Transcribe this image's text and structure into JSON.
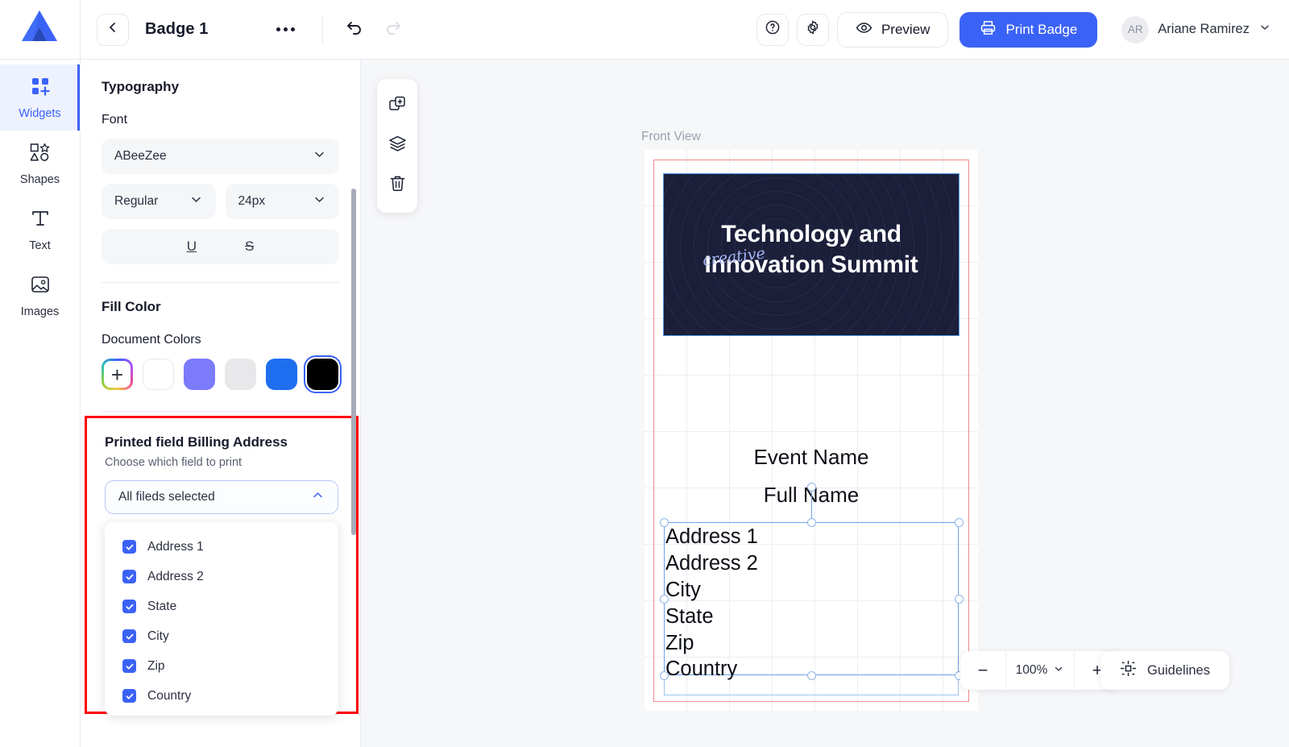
{
  "header": {
    "logo_icon": "app-logo-icon",
    "back_icon": "chevron-left-icon",
    "doc_title": "Badge 1",
    "more_icon": "more-options-icon",
    "undo_icon": "undo-icon",
    "redo_icon": "redo-icon",
    "help_icon": "help-circle-icon",
    "settings_icon": "gear-icon",
    "preview_label": "Preview",
    "preview_icon": "eye-icon",
    "print_label": "Print Badge",
    "print_icon": "printer-icon",
    "user_initials": "AR",
    "user_name": "Ariane Ramirez",
    "user_chevron_icon": "chevron-down-icon",
    "accent_color": "#3b62f6"
  },
  "rail": {
    "items": [
      {
        "label": "Widgets",
        "icon": "widgets-icon",
        "active": true
      },
      {
        "label": "Shapes",
        "icon": "shapes-icon",
        "active": false
      },
      {
        "label": "Text",
        "icon": "text-icon",
        "active": false
      },
      {
        "label": "Images",
        "icon": "images-icon",
        "active": false
      }
    ]
  },
  "panel": {
    "typography_title": "Typography",
    "font_label": "Font",
    "font_family_value": "ABeeZee",
    "font_weight_value": "Regular",
    "font_size_value": "24px",
    "underline_icon": "underline-icon",
    "underline_glyph": "U",
    "strikethrough_icon": "strikethrough-icon",
    "strikethrough_glyph": "S",
    "fill_color_title": "Fill Color",
    "document_colors_label": "Document Colors",
    "swatches": [
      {
        "name": "add-color-swatch",
        "color": "rainbow"
      },
      {
        "name": "swatch-white",
        "color": "#ffffff"
      },
      {
        "name": "swatch-periwinkle",
        "color": "#7b7bfb"
      },
      {
        "name": "swatch-light-gray",
        "color": "#e8e8ea"
      },
      {
        "name": "swatch-blue",
        "color": "#1f6ef0"
      },
      {
        "name": "swatch-black",
        "color": "#000000",
        "selected": true
      }
    ]
  },
  "printed_field": {
    "title": "Printed field Billing Address",
    "subtitle": "Choose which field to print",
    "select_value": "All fileds selected",
    "select_chevron_icon": "chevron-up-icon",
    "highlight_color": "#ff0000",
    "options": [
      {
        "label": "Address 1",
        "checked": true
      },
      {
        "label": "Address 2",
        "checked": true
      },
      {
        "label": "State",
        "checked": true
      },
      {
        "label": "City",
        "checked": true
      },
      {
        "label": "Zip",
        "checked": true
      },
      {
        "label": "Country",
        "checked": true
      }
    ]
  },
  "float_tools": [
    {
      "name": "duplicate-icon"
    },
    {
      "name": "layers-icon"
    },
    {
      "name": "delete-icon"
    }
  ],
  "canvas": {
    "view_label": "Front View",
    "badge": {
      "header_bg": "#1b1f3a",
      "script_word": "creative",
      "title_line1": "Technology and",
      "title_line2": "Innovation Summit",
      "event_name": "Event Name",
      "full_name": "Full Name",
      "address_lines": [
        "Address 1",
        "Address 2",
        "City",
        "State",
        "Zip",
        "Country"
      ]
    }
  },
  "bottom": {
    "zoom_out_glyph": "−",
    "zoom_value": "100%",
    "zoom_chevron_icon": "chevron-down-icon",
    "zoom_in_glyph": "+",
    "guidelines_label": "Guidelines",
    "guidelines_icon": "guidelines-icon"
  }
}
